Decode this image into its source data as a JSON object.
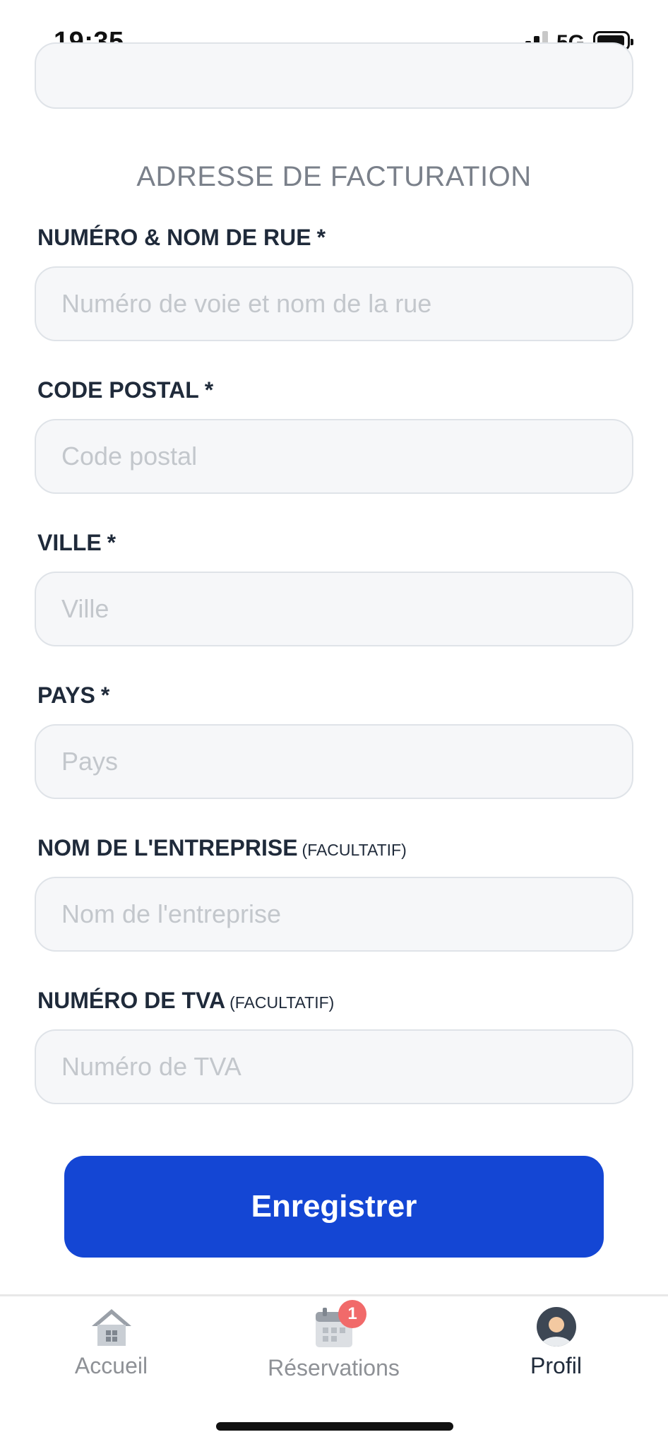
{
  "status_bar": {
    "time": "19:35",
    "network": "5G",
    "signal_bars_active": 3,
    "signal_bars_total": 4,
    "battery_level": 0.9
  },
  "form": {
    "section_title": "ADRESSE DE FACTURATION",
    "required_marker": "*",
    "fields": [
      {
        "label": "NUMÉRO & NOM DE RUE",
        "optional": "",
        "placeholder": "Numéro de voie et nom de la rue",
        "value": ""
      },
      {
        "label": "CODE POSTAL",
        "optional": "",
        "placeholder": "Code postal",
        "value": ""
      },
      {
        "label": "VILLE",
        "optional": "",
        "placeholder": "Ville",
        "value": ""
      },
      {
        "label": "PAYS",
        "optional": "",
        "placeholder": "Pays",
        "value": ""
      },
      {
        "label": "NOM DE L'ENTREPRISE",
        "optional": "(FACULTATIF)",
        "placeholder": "Nom de l'entreprise",
        "value": ""
      },
      {
        "label": "NUMÉRO DE TVA",
        "optional": "(FACULTATIF)",
        "placeholder": "Numéro de TVA",
        "value": ""
      }
    ],
    "save_label": "Enregistrer"
  },
  "tab_bar": {
    "tabs": [
      {
        "label": "Accueil",
        "icon": "home-icon"
      },
      {
        "label": "Réservations",
        "icon": "calendar-icon",
        "badge": "1"
      },
      {
        "label": "Profil",
        "icon": "avatar-icon"
      }
    ],
    "active": "Profil"
  },
  "colors": {
    "primary": "#1446d4",
    "badge": "#f16a6a",
    "input_bg": "#f6f7f9",
    "input_border": "#dfe3e8"
  }
}
